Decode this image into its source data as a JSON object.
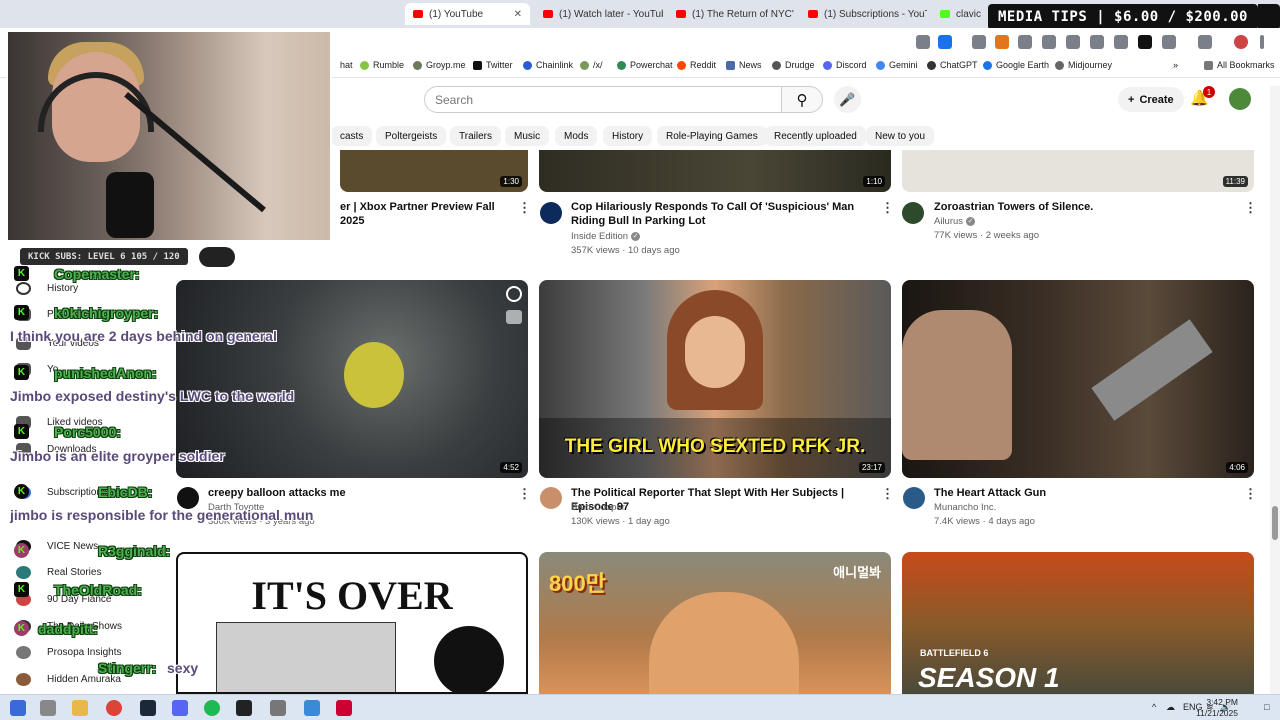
{
  "browser": {
    "tabs": [
      {
        "label": "(1) YouTube",
        "active": true
      },
      {
        "label": "(1) Watch later - YouTube"
      },
      {
        "label": "(1) The Return of NYC's"
      },
      {
        "label": "(1) Subscriptions - YouT"
      },
      {
        "label": "clavic"
      }
    ],
    "bookmarks": [
      "hat",
      "Rumble",
      "Groyp.me",
      "Twitter",
      "Chainlink",
      "/x/",
      "Powerchat",
      "Reddit",
      "News",
      "Drudge",
      "Discord",
      "Gemini",
      "ChatGPT",
      "Google Earth",
      "Midjourney",
      "»",
      "All Bookmarks"
    ]
  },
  "overlay": {
    "media_tips": "MEDIA TIPS | $6.00 / $200.00",
    "kick_subs": "KICK SUBS: LEVEL 6 105 / 120",
    "chat": [
      {
        "user": "Copemaster:",
        "msg": ""
      },
      {
        "user": "k0kichigroyper:",
        "msg": "I think you are 2 days behind on general"
      },
      {
        "user": "punishedAnon:",
        "msg": "Jimbo exposed destiny's LWC to the world"
      },
      {
        "user": "Porc5000:",
        "msg": "Jimbo is an elite groyper soldier"
      },
      {
        "user": "EbicDB:",
        "msg": "jimbo is responsible for the generational mun"
      },
      {
        "user": "R3gginald:",
        "msg": ""
      },
      {
        "user": "TheOldRoad:",
        "msg": ""
      },
      {
        "user": "daddpitt:",
        "msg": ""
      },
      {
        "user": "Stingerr:",
        "msg": "sexy"
      }
    ]
  },
  "youtube": {
    "search_placeholder": "Search",
    "create_label": "Create",
    "notification_count": "1",
    "chips": [
      "casts",
      "Poltergeists",
      "Trailers",
      "Music",
      "Mods",
      "History",
      "Role-Playing Games",
      "Recently uploaded",
      "New to you"
    ],
    "sidebar": [
      "History",
      "Pl",
      "Your videos",
      "Yo",
      "Liked videos",
      "Downloads",
      "Subscriptions",
      "VICE News",
      "Real Stories",
      "90 Day Fiance",
      "The Daily Shows",
      "Prosopa Insights",
      "Hidden Amuraka"
    ],
    "row1": [
      {
        "title": "er | Xbox Partner Preview Fall 2025",
        "duration": "1:30",
        "channel": "",
        "stats": ""
      },
      {
        "title": "Cop Hilariously Responds To Call Of 'Suspicious' Man Riding Bull In Parking Lot",
        "duration": "1:10",
        "channel": "Inside Edition",
        "stats": "357K views · 10 days ago"
      },
      {
        "title": "Zoroastrian Towers of Silence.",
        "duration": "11:39",
        "channel": "Ailurus",
        "stats": "77K views · 2 weeks ago"
      }
    ],
    "row2": [
      {
        "title": "creepy balloon attacks me",
        "duration": "4:52",
        "channel": "Darth Toyotte",
        "stats": "380K views · 3 years ago"
      },
      {
        "title": "The Political Reporter That Slept With Her Subjects | Episode 97",
        "duration": "23:17",
        "channel": "Brett Cooper",
        "stats": "130K views · 1 day ago",
        "caption": "THE GIRL WHO SEXTED RFK JR."
      },
      {
        "title": "The Heart Attack Gun",
        "duration": "4:06",
        "channel": "Munancho Inc.",
        "stats": "7.4K views · 4 days ago"
      }
    ],
    "row3": [
      {
        "thumb_text": "IT'S OVER"
      },
      {
        "thumb_text": "800만",
        "thumb_tag": "애니멀봐"
      },
      {
        "thumb_text": "SEASON 1",
        "thumb_tag": "BATTLEFIELD 6"
      }
    ]
  },
  "taskbar": {
    "lang": "ENG",
    "time": "3:42 PM",
    "date": "11/21/2025"
  },
  "colors": {
    "yt_red": "#ff0000",
    "kick_green": "#53fc18"
  }
}
